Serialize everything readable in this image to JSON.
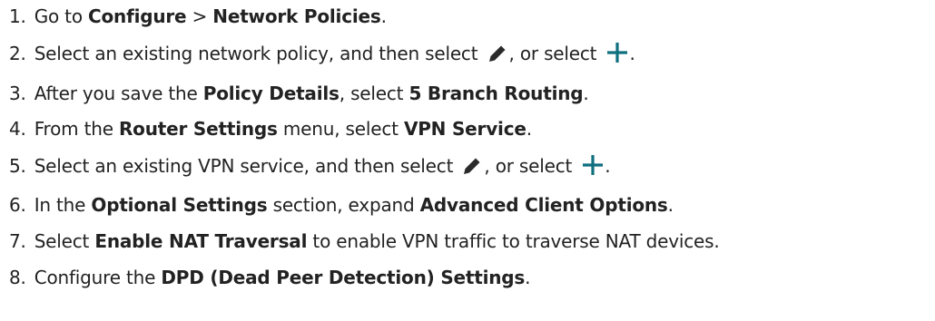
{
  "steps": [
    {
      "num": "1.",
      "parts": [
        "Go to ",
        "Configure",
        " > ",
        "Network Policies",
        "."
      ]
    },
    {
      "num": "2.",
      "parts": [
        "Select an existing network policy, and then select ",
        ", or select ",
        "."
      ],
      "icons": [
        "pencil-icon",
        "plus-icon"
      ]
    },
    {
      "num": "3.",
      "parts": [
        "After you save the ",
        "Policy Details",
        ", select ",
        "5 Branch Routing",
        "."
      ]
    },
    {
      "num": "4.",
      "parts": [
        "From the ",
        "Router Settings",
        " menu, select ",
        "VPN Service",
        "."
      ]
    },
    {
      "num": "5.",
      "parts": [
        "Select an existing VPN service, and then select ",
        ", or select ",
        "."
      ],
      "icons": [
        "pencil-icon",
        "plus-icon"
      ]
    },
    {
      "num": "6.",
      "parts": [
        "In the ",
        "Optional Settings",
        " section, expand ",
        "Advanced Client Options",
        "."
      ]
    },
    {
      "num": "7.",
      "parts": [
        "Select ",
        "Enable NAT Traversal",
        " to enable VPN traffic to traverse NAT devices."
      ]
    },
    {
      "num": "8.",
      "parts": [
        "Configure the ",
        "DPD (Dead Peer Detection) Settings",
        "."
      ]
    }
  ],
  "colors": {
    "text": "#222222",
    "plus_icon": "#0f6f7f",
    "pencil_icon": "#2a2a2a"
  }
}
